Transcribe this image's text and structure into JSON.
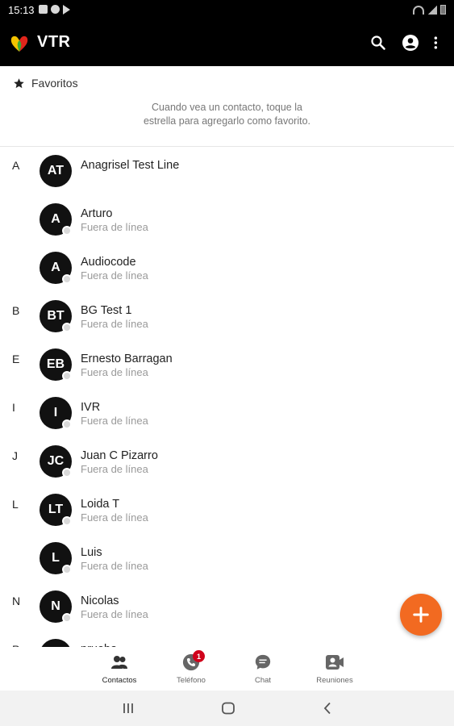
{
  "status_bar": {
    "time": "15:13"
  },
  "app_bar": {
    "title": "VTR",
    "icons": [
      "search-icon",
      "account-icon",
      "more-vert-icon"
    ]
  },
  "favorites": {
    "title": "Favoritos",
    "hint_line1": "Cuando vea un contacto, toque la",
    "hint_line2": "estrella para agregarlo como favorito."
  },
  "contacts": [
    {
      "letter": "A",
      "initials": "AT",
      "name": "Anagrisel Test Line",
      "status": "",
      "presence": false
    },
    {
      "letter": "",
      "initials": "A",
      "name": "Arturo",
      "status": "Fuera de línea",
      "presence": true
    },
    {
      "letter": "",
      "initials": "A",
      "name": "Audiocode",
      "status": "Fuera de línea",
      "presence": true
    },
    {
      "letter": "B",
      "initials": "BT",
      "name": "BG Test 1",
      "status": "Fuera de línea",
      "presence": true
    },
    {
      "letter": "E",
      "initials": "EB",
      "name": "Ernesto Barragan",
      "status": "Fuera de línea",
      "presence": true
    },
    {
      "letter": "I",
      "initials": "I",
      "name": "IVR",
      "status": "Fuera de línea",
      "presence": true
    },
    {
      "letter": "J",
      "initials": "JC",
      "name": "Juan C Pizarro",
      "status": "Fuera de línea",
      "presence": true
    },
    {
      "letter": "L",
      "initials": "LT",
      "name": "Loida T",
      "status": "Fuera de línea",
      "presence": true
    },
    {
      "letter": "",
      "initials": "L",
      "name": "Luis",
      "status": "Fuera de línea",
      "presence": true
    },
    {
      "letter": "N",
      "initials": "N",
      "name": "Nicolas",
      "status": "Fuera de línea",
      "presence": true
    },
    {
      "letter": "P",
      "initials": "P",
      "name": "prueba",
      "status": "",
      "presence": false
    }
  ],
  "fab": {
    "icon": "add-icon",
    "color": "#f26a21"
  },
  "bottom_nav": {
    "items": [
      {
        "label": "Contactos",
        "icon": "contacts-icon",
        "active": true
      },
      {
        "label": "Teléfono",
        "icon": "phone-icon",
        "badge": "1"
      },
      {
        "label": "Chat",
        "icon": "chat-icon"
      },
      {
        "label": "Reuniones",
        "icon": "meetings-icon"
      }
    ]
  },
  "colors": {
    "app_bar": "#000000",
    "accent": "#f26a21",
    "badge": "#d0021b",
    "avatar": "#111111"
  }
}
